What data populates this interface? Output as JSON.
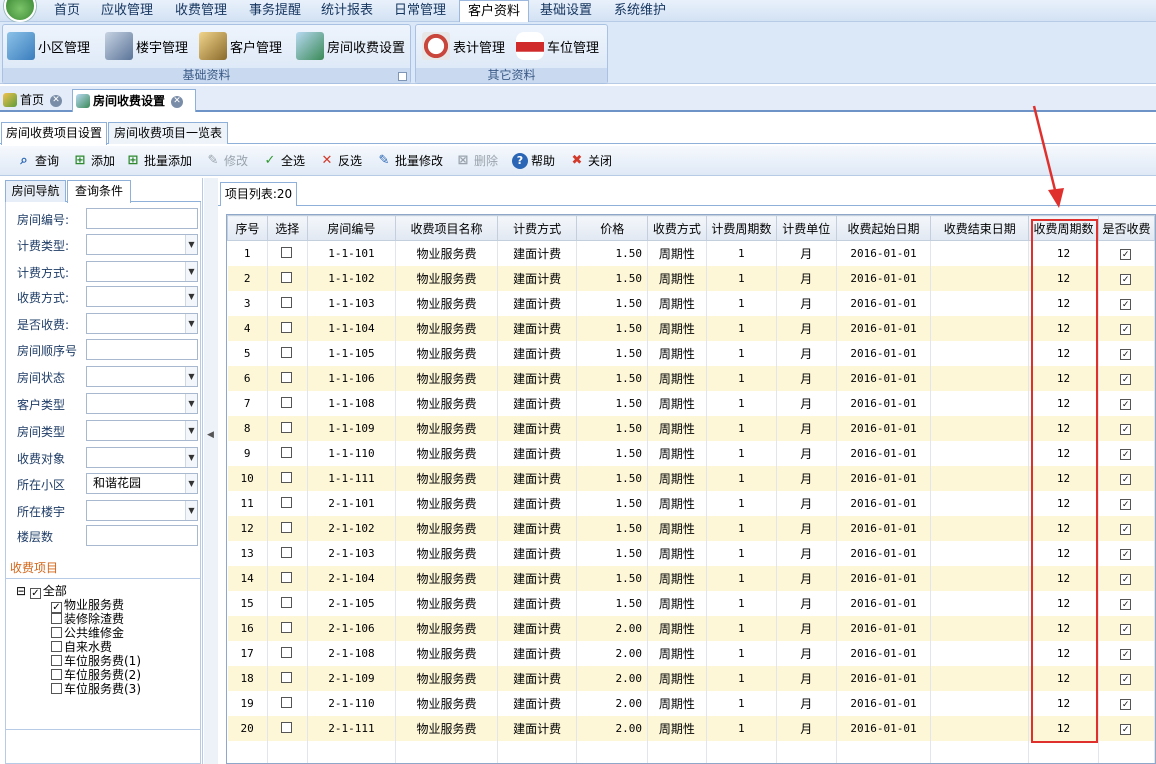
{
  "menu": {
    "items": [
      "首页",
      "应收管理",
      "收费管理",
      "事务提醒",
      "统计报表",
      "日常管理",
      "客户资料",
      "基础设置",
      "系统维护"
    ],
    "active_index": 6
  },
  "ribbon": {
    "groups": [
      {
        "label": "基础资料",
        "buttons": [
          "小区管理",
          "楼宇管理",
          "客户管理",
          "房间收费设置"
        ]
      },
      {
        "label": "其它资料",
        "buttons": [
          "表计管理",
          "车位管理"
        ]
      }
    ]
  },
  "doc_tabs": [
    "首页",
    "房间收费设置"
  ],
  "sub_tabs": [
    "房间收费项目设置",
    "房间收费项目一览表"
  ],
  "toolbar": [
    {
      "label": "查询",
      "icon": "search-icon",
      "enabled": true
    },
    {
      "label": "添加",
      "icon": "add-icon",
      "enabled": true
    },
    {
      "label": "批量添加",
      "icon": "batch-add-icon",
      "enabled": true
    },
    {
      "label": "修改",
      "icon": "edit-icon",
      "enabled": false
    },
    {
      "label": "全选",
      "icon": "check-icon",
      "enabled": true
    },
    {
      "label": "反选",
      "icon": "invert-icon",
      "enabled": true
    },
    {
      "label": "批量修改",
      "icon": "batch-edit-icon",
      "enabled": true
    },
    {
      "label": "删除",
      "icon": "delete-icon",
      "enabled": false
    },
    {
      "label": "帮助",
      "icon": "help-icon",
      "enabled": true
    },
    {
      "label": "关闭",
      "icon": "close-icon",
      "enabled": true
    }
  ],
  "left_tabs": [
    "房间导航",
    "查询条件"
  ],
  "filters": [
    {
      "label": "房间编号:",
      "value": "",
      "dropdown": false
    },
    {
      "label": "计费类型:",
      "value": "",
      "dropdown": true
    },
    {
      "label": "计费方式:",
      "value": "",
      "dropdown": true
    },
    {
      "label": "收费方式:",
      "value": "",
      "dropdown": true
    },
    {
      "label": "是否收费:",
      "value": "",
      "dropdown": true
    },
    {
      "label": "房间顺序号",
      "value": "",
      "dropdown": false
    },
    {
      "label": "房间状态",
      "value": "",
      "dropdown": true
    },
    {
      "label": "客户类型",
      "value": "",
      "dropdown": true
    },
    {
      "label": "房间类型",
      "value": "",
      "dropdown": true
    },
    {
      "label": "收费对象",
      "value": "",
      "dropdown": true
    },
    {
      "label": "所在小区",
      "value": "和谐花园",
      "dropdown": true
    },
    {
      "label": "所在楼宇",
      "value": "",
      "dropdown": true
    },
    {
      "label": "楼层数",
      "value": "",
      "dropdown": false
    }
  ],
  "fee_section_title": "收费项目",
  "fee_tree": {
    "root": "全部",
    "expander": "⊟",
    "items": [
      {
        "label": "物业服务费",
        "checked": true
      },
      {
        "label": "装修除渣费",
        "checked": false
      },
      {
        "label": "公共维修金",
        "checked": false
      },
      {
        "label": "自来水费",
        "checked": false
      },
      {
        "label": "车位服务费(1)",
        "checked": false
      },
      {
        "label": "车位服务费(2)",
        "checked": false
      },
      {
        "label": "车位服务费(3)",
        "checked": false
      }
    ]
  },
  "grid_tab": "项目列表:20",
  "grid": {
    "columns": [
      "序号",
      "选择",
      "房间编号",
      "收费项目名称",
      "计费方式",
      "价格",
      "收费方式",
      "计费周期数",
      "计费单位",
      "收费起始日期",
      "收费结束日期",
      "收费周期数",
      "是否收费"
    ],
    "rows": [
      [
        "1",
        "",
        "1-1-101",
        "物业服务费",
        "建面计费",
        "1.50",
        "周期性",
        "1",
        "月",
        "2016-01-01",
        "",
        "12",
        "✓"
      ],
      [
        "2",
        "",
        "1-1-102",
        "物业服务费",
        "建面计费",
        "1.50",
        "周期性",
        "1",
        "月",
        "2016-01-01",
        "",
        "12",
        "✓"
      ],
      [
        "3",
        "",
        "1-1-103",
        "物业服务费",
        "建面计费",
        "1.50",
        "周期性",
        "1",
        "月",
        "2016-01-01",
        "",
        "12",
        "✓"
      ],
      [
        "4",
        "",
        "1-1-104",
        "物业服务费",
        "建面计费",
        "1.50",
        "周期性",
        "1",
        "月",
        "2016-01-01",
        "",
        "12",
        "✓"
      ],
      [
        "5",
        "",
        "1-1-105",
        "物业服务费",
        "建面计费",
        "1.50",
        "周期性",
        "1",
        "月",
        "2016-01-01",
        "",
        "12",
        "✓"
      ],
      [
        "6",
        "",
        "1-1-106",
        "物业服务费",
        "建面计费",
        "1.50",
        "周期性",
        "1",
        "月",
        "2016-01-01",
        "",
        "12",
        "✓"
      ],
      [
        "7",
        "",
        "1-1-108",
        "物业服务费",
        "建面计费",
        "1.50",
        "周期性",
        "1",
        "月",
        "2016-01-01",
        "",
        "12",
        "✓"
      ],
      [
        "8",
        "",
        "1-1-109",
        "物业服务费",
        "建面计费",
        "1.50",
        "周期性",
        "1",
        "月",
        "2016-01-01",
        "",
        "12",
        "✓"
      ],
      [
        "9",
        "",
        "1-1-110",
        "物业服务费",
        "建面计费",
        "1.50",
        "周期性",
        "1",
        "月",
        "2016-01-01",
        "",
        "12",
        "✓"
      ],
      [
        "10",
        "",
        "1-1-111",
        "物业服务费",
        "建面计费",
        "1.50",
        "周期性",
        "1",
        "月",
        "2016-01-01",
        "",
        "12",
        "✓"
      ],
      [
        "11",
        "",
        "2-1-101",
        "物业服务费",
        "建面计费",
        "1.50",
        "周期性",
        "1",
        "月",
        "2016-01-01",
        "",
        "12",
        "✓"
      ],
      [
        "12",
        "",
        "2-1-102",
        "物业服务费",
        "建面计费",
        "1.50",
        "周期性",
        "1",
        "月",
        "2016-01-01",
        "",
        "12",
        "✓"
      ],
      [
        "13",
        "",
        "2-1-103",
        "物业服务费",
        "建面计费",
        "1.50",
        "周期性",
        "1",
        "月",
        "2016-01-01",
        "",
        "12",
        "✓"
      ],
      [
        "14",
        "",
        "2-1-104",
        "物业服务费",
        "建面计费",
        "1.50",
        "周期性",
        "1",
        "月",
        "2016-01-01",
        "",
        "12",
        "✓"
      ],
      [
        "15",
        "",
        "2-1-105",
        "物业服务费",
        "建面计费",
        "1.50",
        "周期性",
        "1",
        "月",
        "2016-01-01",
        "",
        "12",
        "✓"
      ],
      [
        "16",
        "",
        "2-1-106",
        "物业服务费",
        "建面计费",
        "2.00",
        "周期性",
        "1",
        "月",
        "2016-01-01",
        "",
        "12",
        "✓"
      ],
      [
        "17",
        "",
        "2-1-108",
        "物业服务费",
        "建面计费",
        "2.00",
        "周期性",
        "1",
        "月",
        "2016-01-01",
        "",
        "12",
        "✓"
      ],
      [
        "18",
        "",
        "2-1-109",
        "物业服务费",
        "建面计费",
        "2.00",
        "周期性",
        "1",
        "月",
        "2016-01-01",
        "",
        "12",
        "✓"
      ],
      [
        "19",
        "",
        "2-1-110",
        "物业服务费",
        "建面计费",
        "2.00",
        "周期性",
        "1",
        "月",
        "2016-01-01",
        "",
        "12",
        "✓"
      ],
      [
        "20",
        "",
        "2-1-111",
        "物业服务费",
        "建面计费",
        "2.00",
        "周期性",
        "1",
        "月",
        "2016-01-01",
        "",
        "12",
        "✓"
      ]
    ]
  },
  "colors": {
    "alt_row": "#fdf7d8",
    "highlight": "#e0302e",
    "fee_title": "#d2661a",
    "tab_border": "#8fb0d9"
  }
}
